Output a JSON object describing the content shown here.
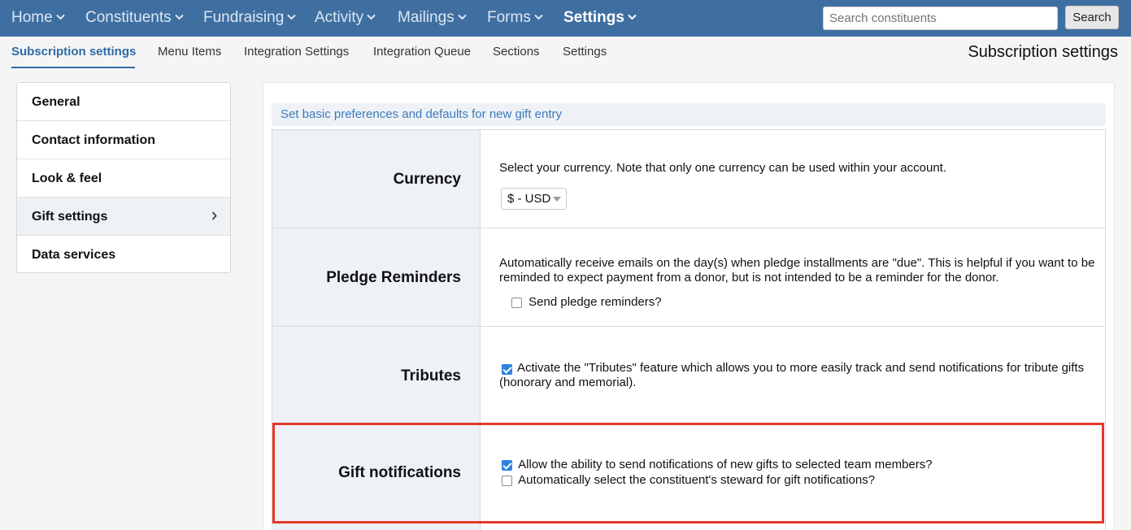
{
  "nav": {
    "items": [
      {
        "label": "Home"
      },
      {
        "label": "Constituents"
      },
      {
        "label": "Fundraising"
      },
      {
        "label": "Activity"
      },
      {
        "label": "Mailings"
      },
      {
        "label": "Forms"
      },
      {
        "label": "Settings"
      }
    ],
    "search_placeholder": "Search constituents",
    "search_button": "Search"
  },
  "subnav": {
    "items": [
      {
        "label": "Subscription settings"
      },
      {
        "label": "Menu Items"
      },
      {
        "label": "Integration Settings"
      },
      {
        "label": "Integration Queue"
      },
      {
        "label": "Sections"
      },
      {
        "label": "Settings"
      }
    ],
    "page_title": "Subscription settings"
  },
  "sidebar": {
    "items": [
      {
        "label": "General"
      },
      {
        "label": "Contact information"
      },
      {
        "label": "Look & feel"
      },
      {
        "label": "Gift settings"
      },
      {
        "label": "Data services"
      }
    ]
  },
  "main": {
    "intro": "Set basic preferences and defaults for new gift entry",
    "currency": {
      "label": "Currency",
      "description": "Select your currency. Note that only one currency can be used within your account.",
      "selected": "$ - USD"
    },
    "pledge_reminders": {
      "label": "Pledge Reminders",
      "description": "Automatically receive emails on the day(s) when pledge installments are \"due\". This is helpful if you want to be reminded to expect payment from a donor, but is not intended to be a reminder for the donor.",
      "checkbox_label": "Send pledge reminders?",
      "checked": false
    },
    "tributes": {
      "label": "Tributes",
      "checkbox_label": "Activate the \"Tributes\" feature which allows you to more easily track and send notifications for tribute gifts (honorary and memorial).",
      "checked": true
    },
    "gift_notifications": {
      "label": "Gift notifications",
      "option1": "Allow the ability to send notifications of new gifts to selected team members?",
      "option1_checked": true,
      "option2": "Automatically select the constituent's steward for gift notifications?",
      "option2_checked": false
    }
  },
  "colors": {
    "nav_bg": "#3f6fa0",
    "accent": "#2d6aa8",
    "highlight": "#e4392b",
    "checkbox_checked": "#2a82e4"
  }
}
